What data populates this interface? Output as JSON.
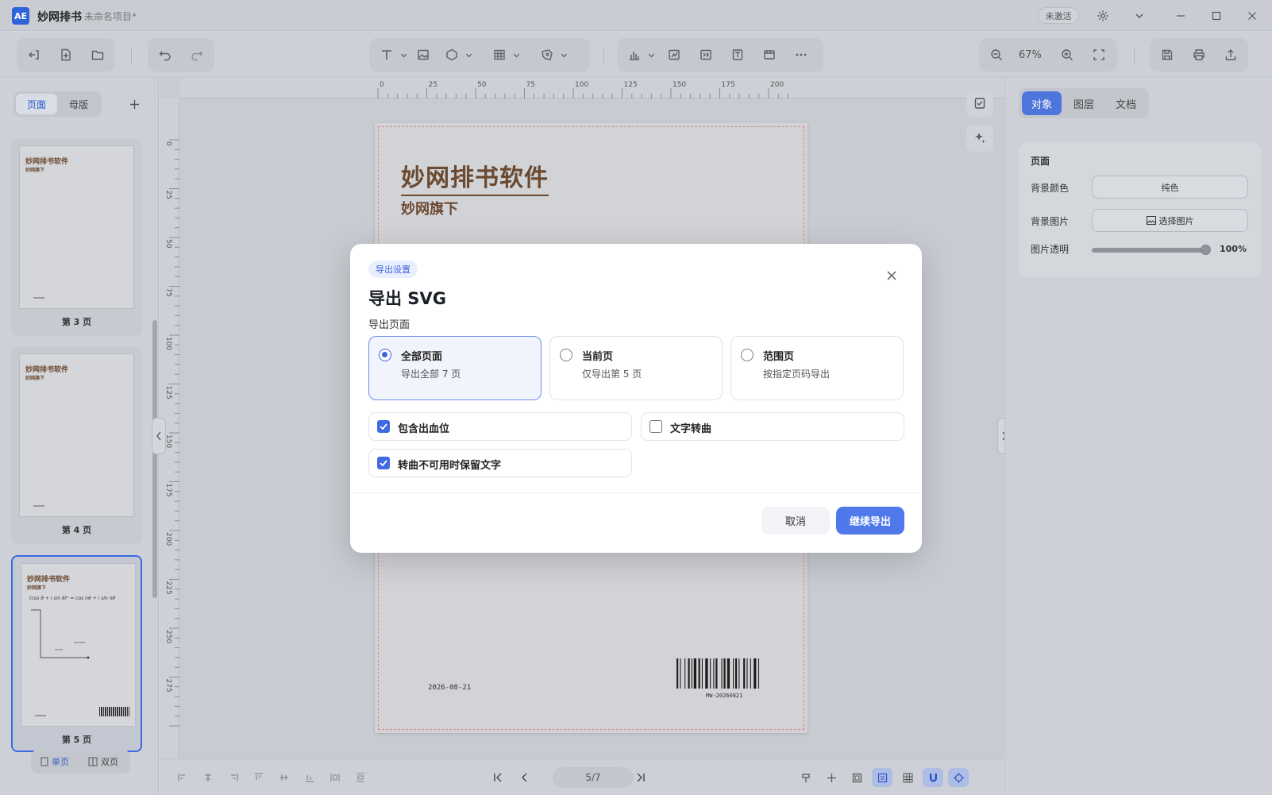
{
  "titlebar": {
    "app_name": "妙网排书",
    "doc_name": "未命名项目*",
    "activate_label": "未激活",
    "logo_text": "AE"
  },
  "toolbar": {
    "zoom": "67%"
  },
  "left_panel": {
    "tabs": [
      "页面",
      "母版"
    ],
    "thumbnails": [
      {
        "label": "第 3 页",
        "title": "妙网排书软件",
        "subtitle": "妙网旗下"
      },
      {
        "label": "第 4 页",
        "title": "妙网排书软件",
        "subtitle": "妙网旗下"
      },
      {
        "label": "第 5 页",
        "title": "妙网排书软件",
        "subtitle": "妙网旗下",
        "formula": "(cos θ + i sin θ)ⁿ = cos nθ + i sin nθ"
      }
    ],
    "view_modes": [
      "单页",
      "双页"
    ]
  },
  "ruler": {
    "h_ticks": [
      "0",
      "25",
      "50",
      "75",
      "100",
      "125",
      "150",
      "175",
      "200"
    ],
    "v_ticks": [
      "0",
      "25",
      "50",
      "75",
      "100",
      "125",
      "150",
      "175",
      "200",
      "225",
      "250",
      "275"
    ]
  },
  "page": {
    "title": "妙网排书软件",
    "subtitle": "妙网旗下",
    "date": "2026-08-21",
    "barcode_text": "MW-20260821"
  },
  "pager": {
    "value": "5/7"
  },
  "right_panel": {
    "tabs": [
      "对象",
      "图层",
      "文档"
    ],
    "section_title": "页面",
    "bg_color_label": "背景颜色",
    "bg_color_value": "纯色",
    "bg_image_label": "背景图片",
    "bg_image_button": "选择图片",
    "opacity_label": "图片透明",
    "opacity_value": "100%",
    "opacity_level": 1.0
  },
  "modal": {
    "badge": "导出设置",
    "title": "导出 SVG",
    "section_label": "导出页面",
    "options": [
      {
        "title": "全部页面",
        "desc": "导出全部 7 页",
        "selected": true
      },
      {
        "title": "当前页",
        "desc": "仅导出第 5 页",
        "selected": false
      },
      {
        "title": "范围页",
        "desc": "按指定页码导出",
        "selected": false
      }
    ],
    "checkboxes": [
      {
        "label": "包含出血位",
        "checked": true
      },
      {
        "label": "文字转曲",
        "checked": false
      },
      {
        "label": "转曲不可用时保留文字",
        "checked": true
      }
    ],
    "cancel_label": "取消",
    "continue_label": "继续导出"
  },
  "colors": {
    "accent": "#4f79ea",
    "brown": "#6b4a32"
  }
}
